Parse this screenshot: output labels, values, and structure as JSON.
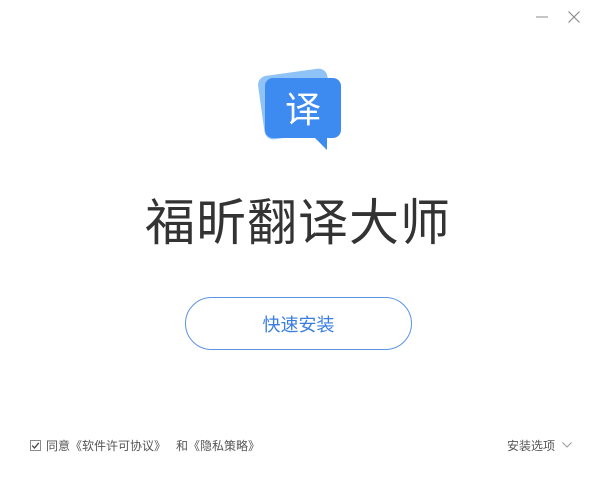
{
  "window": {
    "minimize_icon": "minimize-icon",
    "close_icon": "close-icon"
  },
  "logo": {
    "glyph": "译",
    "colors": {
      "front": "#3d8bf0",
      "back": "#8fc3f7"
    }
  },
  "app_title": "福昕翻译大师",
  "install_button": "快速安装",
  "agreement": {
    "checked": true,
    "prefix": "同意",
    "license_link": "《软件许可协议》",
    "conjunction": "和",
    "privacy_link": "《隐私策略》"
  },
  "install_options": "安装选项",
  "colors": {
    "accent": "#3a7ee0",
    "button_border": "#5b93e6",
    "title_text": "#333333"
  }
}
